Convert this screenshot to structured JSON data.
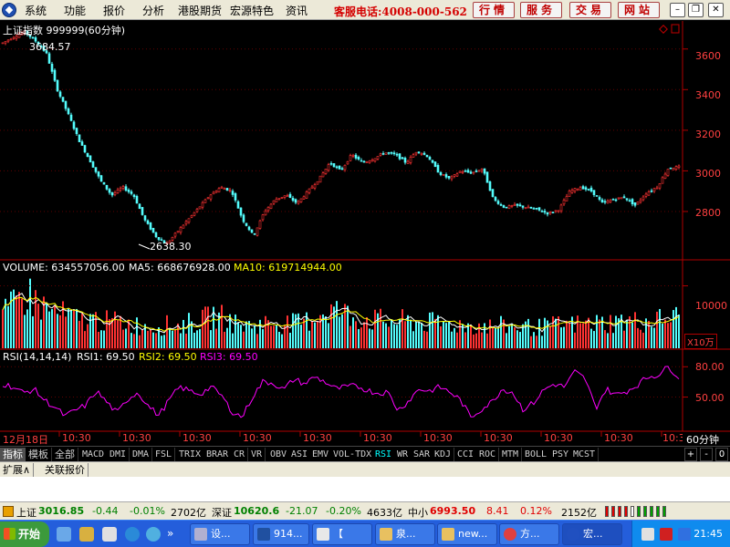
{
  "menubar": {
    "items": [
      "系统",
      "功能",
      "报价",
      "分析",
      "港股期货",
      "宏源特色",
      "资讯"
    ],
    "hotline": "客服电话:4008-000-562",
    "buttons": [
      "行情",
      "服务",
      "交易",
      "网站"
    ],
    "window_controls": [
      "minimize-icon",
      "restore-icon",
      "close-icon"
    ]
  },
  "price_panel": {
    "title": "上证指数 999999(60分钟)",
    "high_label": "3684.57",
    "low_label": "2638.30",
    "y_ticks": [
      "3600",
      "3400",
      "3200",
      "3000",
      "2800"
    ]
  },
  "volume_panel": {
    "label_prefix": "VOLUME: 634557056.00",
    "ma5": "MA5: 668676928.00",
    "ma10": "MA10: 619714944.00",
    "y_tick": "10000",
    "unit": "X10万"
  },
  "rsi_panel": {
    "label_prefix": "RSI(14,14,14)",
    "rsi1": "RSI1: 69.50",
    "rsi2": "RSI2: 69.50",
    "rsi3": "RSI3: 69.50",
    "y_ticks": [
      "80.00",
      "50.00"
    ]
  },
  "time_axis": {
    "first": "12月18日",
    "labels": [
      "10:30",
      "10:30",
      "10:30",
      "10:30",
      "10:30",
      "10:30",
      "10:30",
      "10:30",
      "10:30",
      "10:30",
      "10:30"
    ],
    "period": "60分钟"
  },
  "indicator_tabs": [
    "指标",
    "模板",
    "全部",
    "MACD",
    "DMI",
    "DMA",
    "FSL",
    "TRIX",
    "BRAR",
    "CR",
    "VR",
    "OBV",
    "ASI",
    "EMV",
    "VOL-TDX",
    "RSI",
    "WR",
    "SAR",
    "KDJ",
    "CCI",
    "ROC",
    "MTM",
    "BOLL",
    "PSY",
    "MCST"
  ],
  "active_indicator": "RSI",
  "small_buttons": [
    "+",
    "-",
    "0"
  ],
  "expand_bar": {
    "tabs": [
      "扩展∧",
      "关联报价"
    ]
  },
  "statusbar": {
    "sh_name": "上证",
    "sh_value": "3016.85",
    "sh_change": "-0.44",
    "sh_pct": "-0.01%",
    "sh_amount": "2702亿",
    "sz_name": "深证",
    "sz_value": "10620.6",
    "sz_change": "-21.07",
    "sz_pct": "-0.20%",
    "sz_amount": "4633亿",
    "sme_name": "中小",
    "sme_value": "6993.50",
    "sme_change": "8.41",
    "sme_pct": "0.12%",
    "sme_amount": "2152亿"
  },
  "taskbar": {
    "start_label": "开始",
    "tasks": [
      "设...",
      "914...",
      "【",
      "泉...",
      "new...",
      "方...",
      "宏..."
    ],
    "clock": "21:45"
  },
  "colors": {
    "up": "#ff3232",
    "down": "#54fcfc",
    "ma5": "#ffffff",
    "ma10": "#ffff00",
    "rsi": "#ff00ff",
    "axis": "#b00000",
    "label_red": "#ff0000"
  },
  "chart_data": {
    "type": "candlestick",
    "series_price_range": [
      2638.3,
      3684.57
    ],
    "ylim_price": [
      2580,
      3720
    ],
    "ylim_volume": [
      0,
      13000
    ],
    "ylim_rsi": [
      18,
      92
    ],
    "price_path": [
      3630,
      3660,
      3684.57,
      3640,
      3580,
      3400,
      3280,
      3150,
      3050,
      2950,
      2880,
      2920,
      2880,
      2760,
      2680,
      2638.3,
      2700,
      2760,
      2820,
      2880,
      2920,
      2900,
      2760,
      2680,
      2800,
      2860,
      2880,
      2840,
      2900,
      2960,
      3040,
      3000,
      3080,
      3040,
      3060,
      3090,
      3080,
      3040,
      3100,
      3070,
      2990,
      2960,
      3000,
      2990,
      3010,
      2860,
      2820,
      2830,
      2820,
      2810,
      2790,
      2810,
      2900,
      2920,
      2900,
      2840,
      2860,
      2870,
      2830,
      2890,
      2920,
      3010,
      3020
    ],
    "volume_path": [
      5200,
      6800,
      8900,
      7200,
      6000,
      5400,
      4800,
      4400,
      4600,
      4200,
      4300,
      3800,
      3600,
      3500,
      3700,
      3600,
      4000,
      4300,
      5200,
      4800,
      3900,
      3600,
      3800,
      4100,
      4000,
      3900,
      4200,
      5600,
      6200,
      5800,
      5000,
      4800,
      4500,
      4300,
      4400,
      4200,
      4100,
      4000,
      3900,
      3800,
      3700,
      3600,
      3500,
      3600,
      3500,
      3400,
      3300,
      3600,
      3700,
      3800,
      3900,
      4000,
      4100,
      4300,
      4200,
      4300,
      4500,
      4700,
      5000
    ],
    "rsi_path": [
      63,
      60,
      54,
      58,
      47,
      40,
      31,
      37,
      42,
      56,
      45,
      34,
      48,
      55,
      41,
      32,
      47,
      60,
      56,
      53,
      60,
      52,
      36,
      30,
      50,
      65,
      64,
      57,
      68,
      63,
      70,
      65,
      58,
      60,
      61,
      57,
      54,
      55,
      37,
      46,
      58,
      56,
      60,
      55,
      47,
      30,
      38,
      45,
      58,
      55,
      38,
      44,
      57,
      63,
      60,
      75,
      68,
      39,
      58,
      52,
      56,
      62,
      70,
      72,
      80,
      70
    ]
  }
}
